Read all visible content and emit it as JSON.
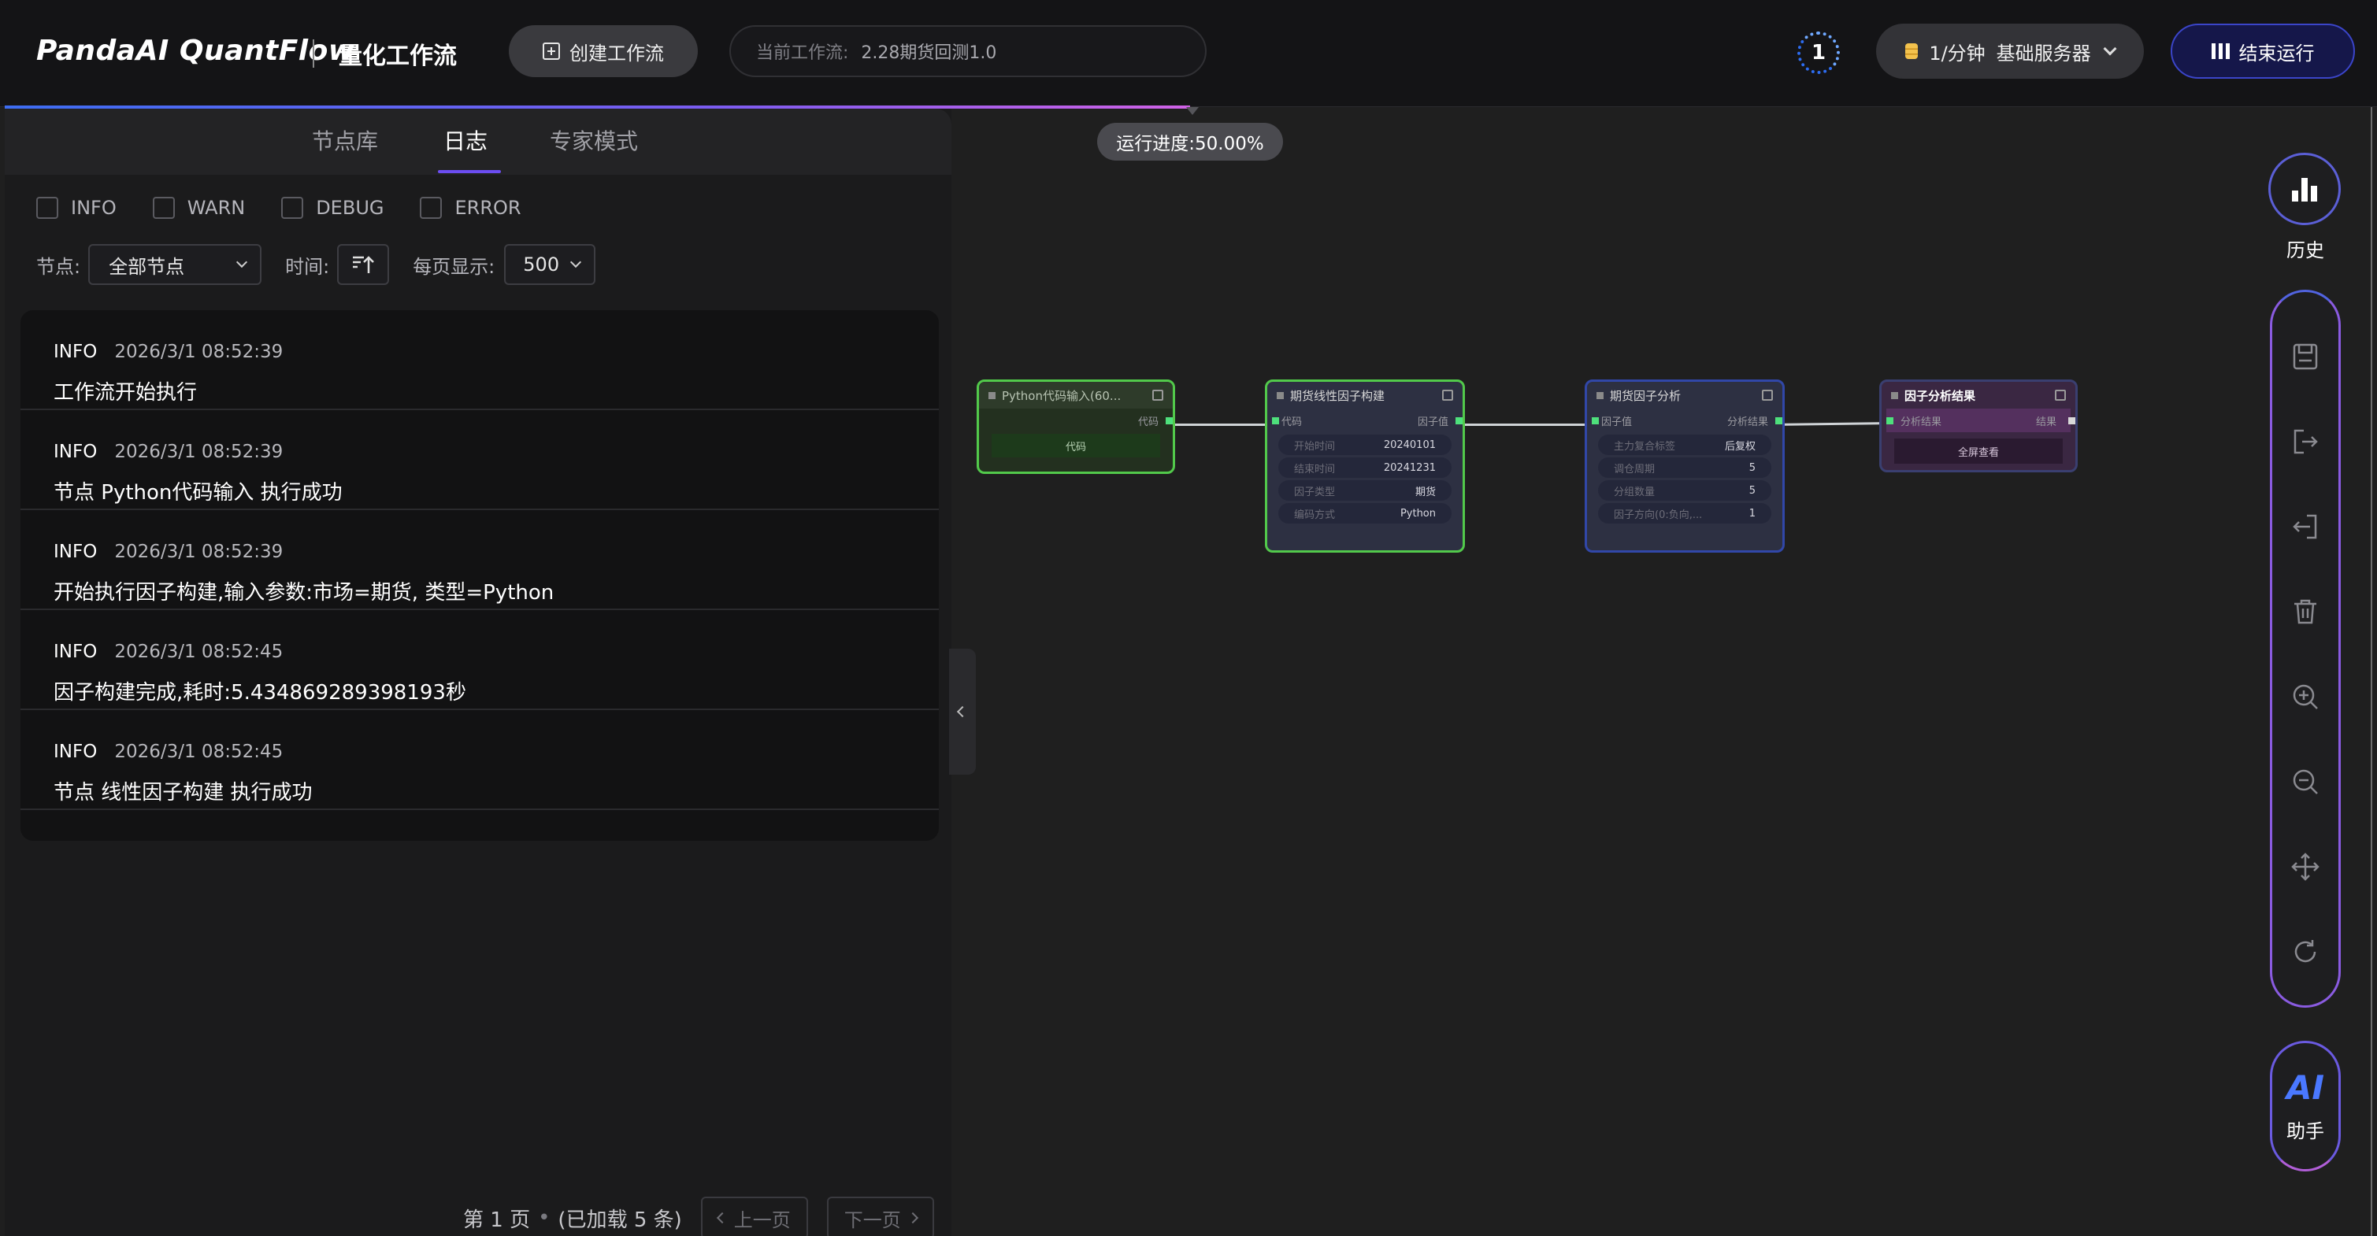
{
  "header": {
    "brand": "PandaAI QuantFlow",
    "subtitle": "量化工作流",
    "create_label": "创建工作流",
    "current_flow_label": "当前工作流:",
    "current_flow_value": "2.28期货回测1.0",
    "task_count": "1",
    "server_rate": "1/分钟",
    "server_name": "基础服务器",
    "stop_label": "结束运行"
  },
  "progress": {
    "label": "运行进度:50.00%",
    "value": 0.5
  },
  "left_panel": {
    "tabs": [
      {
        "label": "节点库",
        "active": false
      },
      {
        "label": "日志",
        "active": true
      },
      {
        "label": "专家模式",
        "active": false
      }
    ],
    "levels": [
      "INFO",
      "WARN",
      "DEBUG",
      "ERROR"
    ],
    "node_label": "节点:",
    "node_value": "全部节点",
    "time_label": "时间:",
    "per_page_label": "每页显示:",
    "per_page_value": "500",
    "logs": [
      {
        "level": "INFO",
        "time": "2026/3/1 08:52:39",
        "message": "工作流开始执行"
      },
      {
        "level": "INFO",
        "time": "2026/3/1 08:52:39",
        "message": "节点 Python代码输入 执行成功"
      },
      {
        "level": "INFO",
        "time": "2026/3/1 08:52:39",
        "message": "开始执行因子构建,输入参数:市场=期货, 类型=Python"
      },
      {
        "level": "INFO",
        "time": "2026/3/1 08:52:45",
        "message": "因子构建完成,耗时:5.434869289398193秒"
      },
      {
        "level": "INFO",
        "time": "2026/3/1 08:52:45",
        "message": "节点 线性因子构建 执行成功"
      }
    ],
    "pager": {
      "page": "第 1 页",
      "loaded": "(已加载 5 条)",
      "prev": "上一页",
      "next": "下一页"
    }
  },
  "canvas": {
    "nodes": {
      "python_input": {
        "title": "Python代码输入(60...",
        "output": "代码",
        "button": "代码"
      },
      "linear_factor": {
        "title": "期货线性因子构建",
        "input": "代码",
        "output": "因子值",
        "params": [
          {
            "name": "开始时间",
            "value": "20240101"
          },
          {
            "name": "结束时间",
            "value": "20241231"
          },
          {
            "name": "因子类型",
            "value": "期货"
          },
          {
            "name": "编码方式",
            "value": "Python"
          }
        ]
      },
      "factor_analysis": {
        "title": "期货因子分析",
        "input": "因子值",
        "output": "分析结果",
        "params": [
          {
            "name": "主力复合标签",
            "value": "后复权"
          },
          {
            "name": "调仓周期",
            "value": "5"
          },
          {
            "name": "分组数量",
            "value": "5"
          },
          {
            "name": "因子方向(0:负向,...",
            "value": "1"
          }
        ]
      },
      "result": {
        "title": "因子分析结果",
        "input": "分析结果",
        "output": "结果",
        "button": "全屏查看"
      }
    }
  },
  "right_rail": {
    "history_label": "历史",
    "tools": [
      "save-icon",
      "export-icon",
      "import-icon",
      "delete-icon",
      "zoom-in-icon",
      "zoom-out-icon",
      "move-icon",
      "refresh-icon"
    ],
    "ai_label": "AI",
    "ai_sub": "助手"
  },
  "colors": {
    "accent": "#6c4df2",
    "stop_button_border": "#3b45c9",
    "success_port": "#4ee07c"
  }
}
